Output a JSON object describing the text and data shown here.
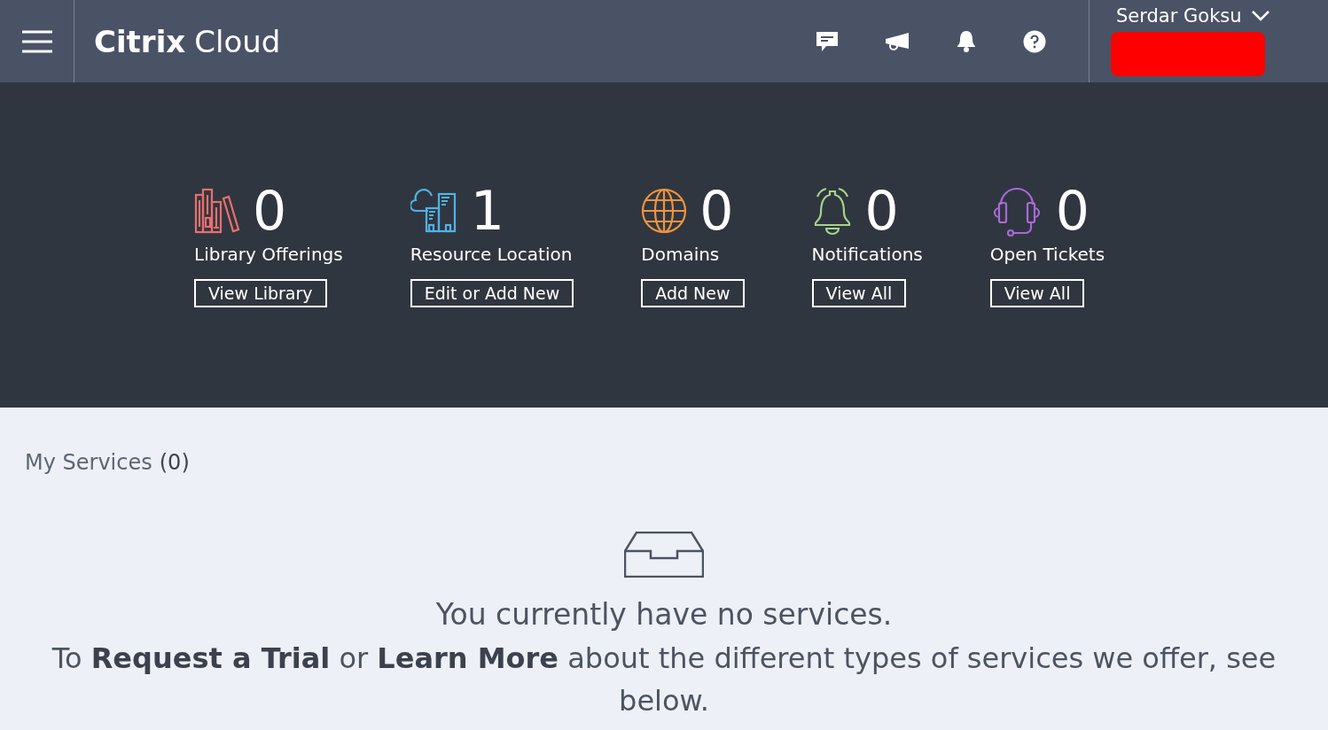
{
  "header": {
    "brand_bold": "Citrix",
    "brand_light": "Cloud",
    "user": {
      "name": "Serdar Goksu"
    }
  },
  "stats": [
    {
      "kind": "library",
      "color": "#e8706f",
      "count": "0",
      "label": "Library Offerings",
      "action": "View Library"
    },
    {
      "kind": "location",
      "color": "#4fb3e8",
      "count": "1",
      "label": "Resource Location",
      "action": "Edit or Add New"
    },
    {
      "kind": "domains",
      "color": "#ee9440",
      "count": "0",
      "label": "Domains",
      "action": "Add New"
    },
    {
      "kind": "notifications",
      "color": "#a6d38a",
      "count": "0",
      "label": "Notifications",
      "action": "View All"
    },
    {
      "kind": "tickets",
      "color": "#a66ad8",
      "count": "0",
      "label": "Open Tickets",
      "action": "View All"
    }
  ],
  "services": {
    "title": "My Services",
    "count": "(0)",
    "empty_title": "You currently have no services.",
    "empty_text": "To **Request a Trial** or **Learn More** about the different types of services we offer, see below."
  }
}
